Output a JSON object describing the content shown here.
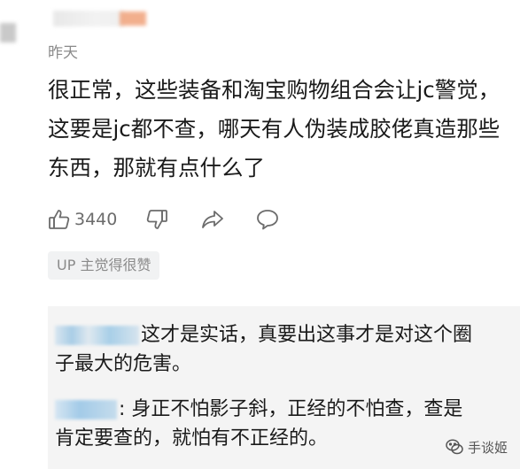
{
  "comment": {
    "timestamp": "昨天",
    "lines": [
      "很正常，这些装备和淘宝购物组合会让jc警觉，",
      "这要是jc都不查，哪天有人伪装成胶佬真造那些",
      "东西，那就有点什么了"
    ],
    "like_count": "3440",
    "up_badge": "UP 主觉得很赞"
  },
  "replies": [
    {
      "lines": [
        "这才是实话，真要出这事才是对这个圈",
        "子最大的危害。"
      ]
    },
    {
      "lines": [
        ": 身正不怕影子斜，正经的不怕查，查是",
        "肯定要查的，就怕有不正经的。"
      ]
    }
  ],
  "watermark": {
    "text": "手谈姬"
  },
  "colors": {
    "text": "#1a1a1a",
    "muted": "#8a8a8a",
    "icon": "#6c6c6c",
    "reply_bg": "#f4f4f4",
    "badge_bg": "#f1f2f3"
  }
}
